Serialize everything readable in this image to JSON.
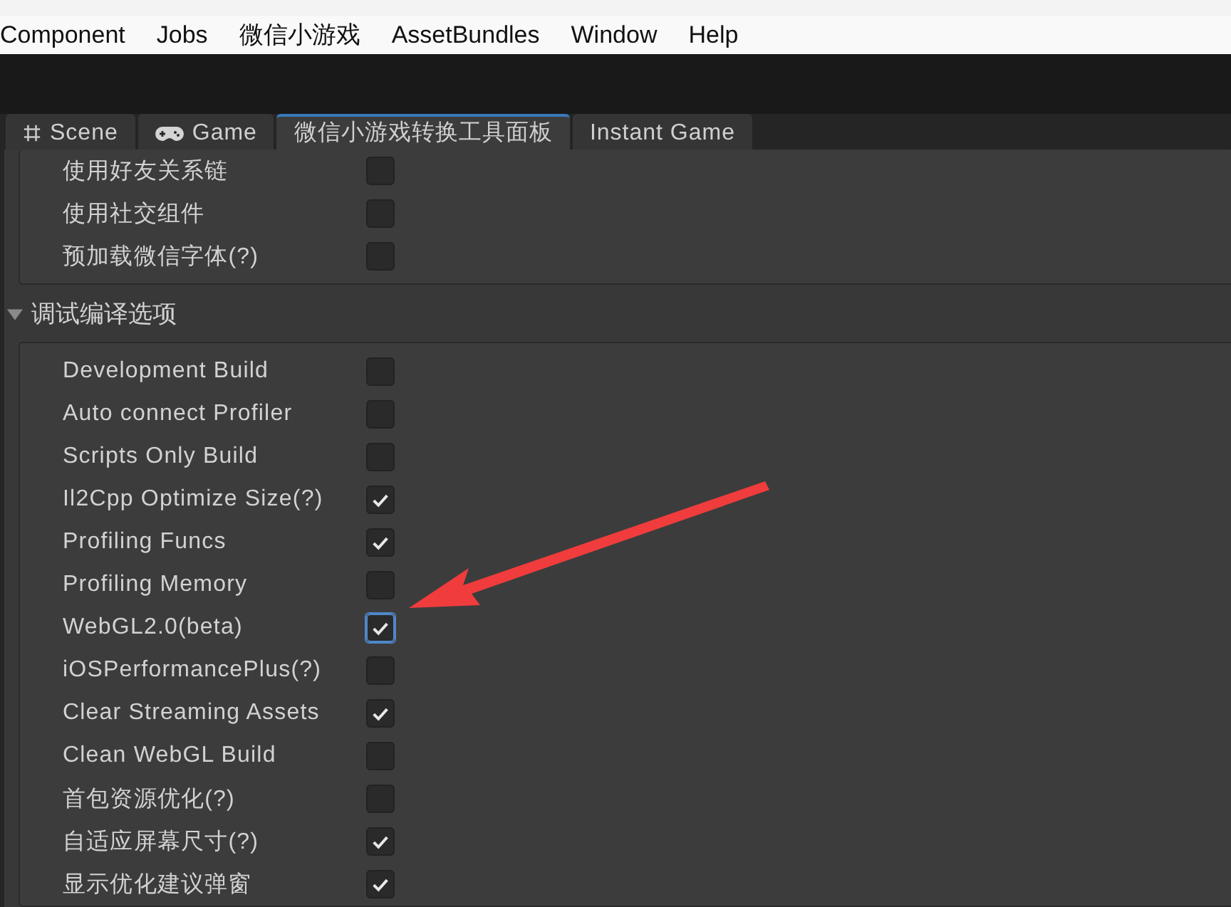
{
  "menu": [
    "Component",
    "Jobs",
    "微信小游戏",
    "AssetBundles",
    "Window",
    "Help"
  ],
  "tabs": [
    {
      "label": "Scene",
      "kind": "scene",
      "selected": false
    },
    {
      "label": "Game",
      "kind": "game",
      "selected": false
    },
    {
      "label": "微信小游戏转换工具面板",
      "kind": "plain",
      "selected": true
    },
    {
      "label": "Instant Game",
      "kind": "plain",
      "selected": false
    }
  ],
  "top_options": [
    {
      "label": "使用好友关系链",
      "checked": false,
      "focused": false
    },
    {
      "label": "使用社交组件",
      "checked": false,
      "focused": false
    },
    {
      "label": "预加载微信字体(?)",
      "checked": false,
      "focused": false
    }
  ],
  "section": {
    "title": "调试编译选项",
    "expanded": true,
    "options": [
      {
        "label": "Development Build",
        "checked": false,
        "focused": false
      },
      {
        "label": "Auto connect Profiler",
        "checked": false,
        "focused": false
      },
      {
        "label": "Scripts Only Build",
        "checked": false,
        "focused": false
      },
      {
        "label": "Il2Cpp Optimize Size(?)",
        "checked": true,
        "focused": false
      },
      {
        "label": "Profiling Funcs",
        "checked": true,
        "focused": false
      },
      {
        "label": "Profiling Memory",
        "checked": false,
        "focused": false
      },
      {
        "label": "WebGL2.0(beta)",
        "checked": true,
        "focused": true
      },
      {
        "label": "iOSPerformancePlus(?)",
        "checked": false,
        "focused": false
      },
      {
        "label": "Clear Streaming Assets",
        "checked": true,
        "focused": false
      },
      {
        "label": "Clean WebGL Build",
        "checked": false,
        "focused": false
      },
      {
        "label": "首包资源优化(?)",
        "checked": false,
        "focused": false
      },
      {
        "label": "自适应屏幕尺寸(?)",
        "checked": true,
        "focused": false
      },
      {
        "label": "显示优化建议弹窗",
        "checked": true,
        "focused": false
      }
    ]
  }
}
